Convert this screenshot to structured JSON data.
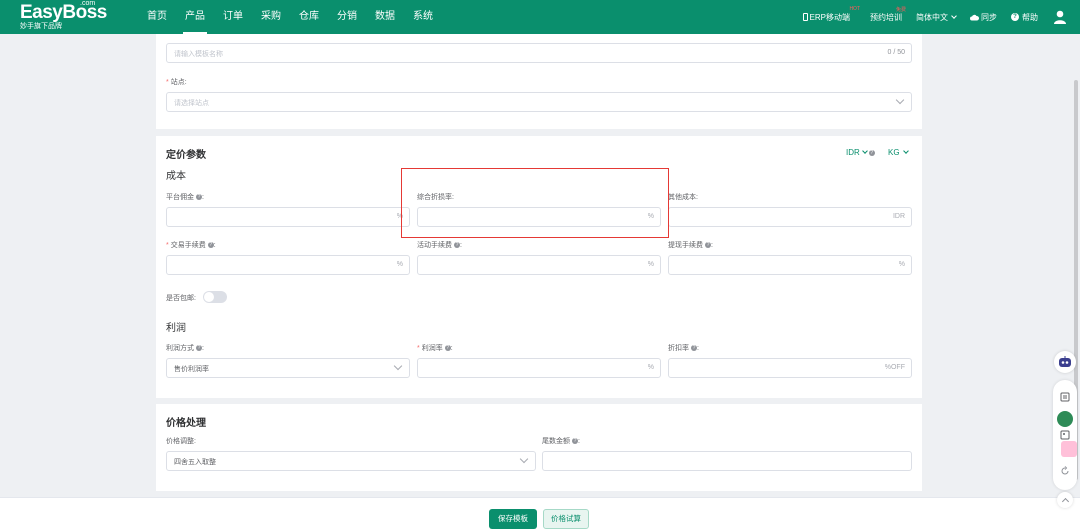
{
  "brand": {
    "name": "EasyBoss",
    "com": ".com",
    "sub": "妙手旗下品牌"
  },
  "nav": {
    "items": [
      {
        "label": "首页"
      },
      {
        "label": "产品"
      },
      {
        "label": "订单"
      },
      {
        "label": "采购"
      },
      {
        "label": "仓库"
      },
      {
        "label": "分销"
      },
      {
        "label": "数据"
      },
      {
        "label": "系统"
      }
    ],
    "active": "产品",
    "erp_mobile": "ERP移动端",
    "erp_badge": "HOT",
    "training": "预约培训",
    "training_badge": "免费",
    "language": "简体中文",
    "sync": "同步",
    "help": "帮助"
  },
  "template": {
    "name_placeholder": "请输入模板名称",
    "name_counter": "0 / 50",
    "site_label": "站点:",
    "site_placeholder": "请选择站点"
  },
  "pricing": {
    "title": "定价参数",
    "currency": "IDR",
    "weight_unit": "KG",
    "cost_title": "成本",
    "platform_commission": "平台佣金",
    "comprehensive_loss_rate": "综合折损率:",
    "other_cost": "其他成本:",
    "transaction_fee": "交易手续费",
    "activity_fee": "活动手续费",
    "withdrawal_fee": "提现手续费",
    "percent": "%",
    "idr_suffix": "IDR",
    "free_shipping": "是否包邮:",
    "profit_title": "利润",
    "profit_method": "利润方式",
    "profit_method_value": "售价利润率",
    "profit_rate": "利润率",
    "discount_rate": "折扣率",
    "off_suffix": "%OFF"
  },
  "price_processing": {
    "title": "价格处理",
    "adjust_label": "价格调整:",
    "adjust_value": "四舍五入取整",
    "tail_amount": "尾数金额"
  },
  "footer": {
    "save": "保存模板",
    "trial": "价格试算"
  },
  "colors": {
    "brand": "#0a8f6d",
    "highlight": "#e53935",
    "required": "#f56c6c"
  }
}
